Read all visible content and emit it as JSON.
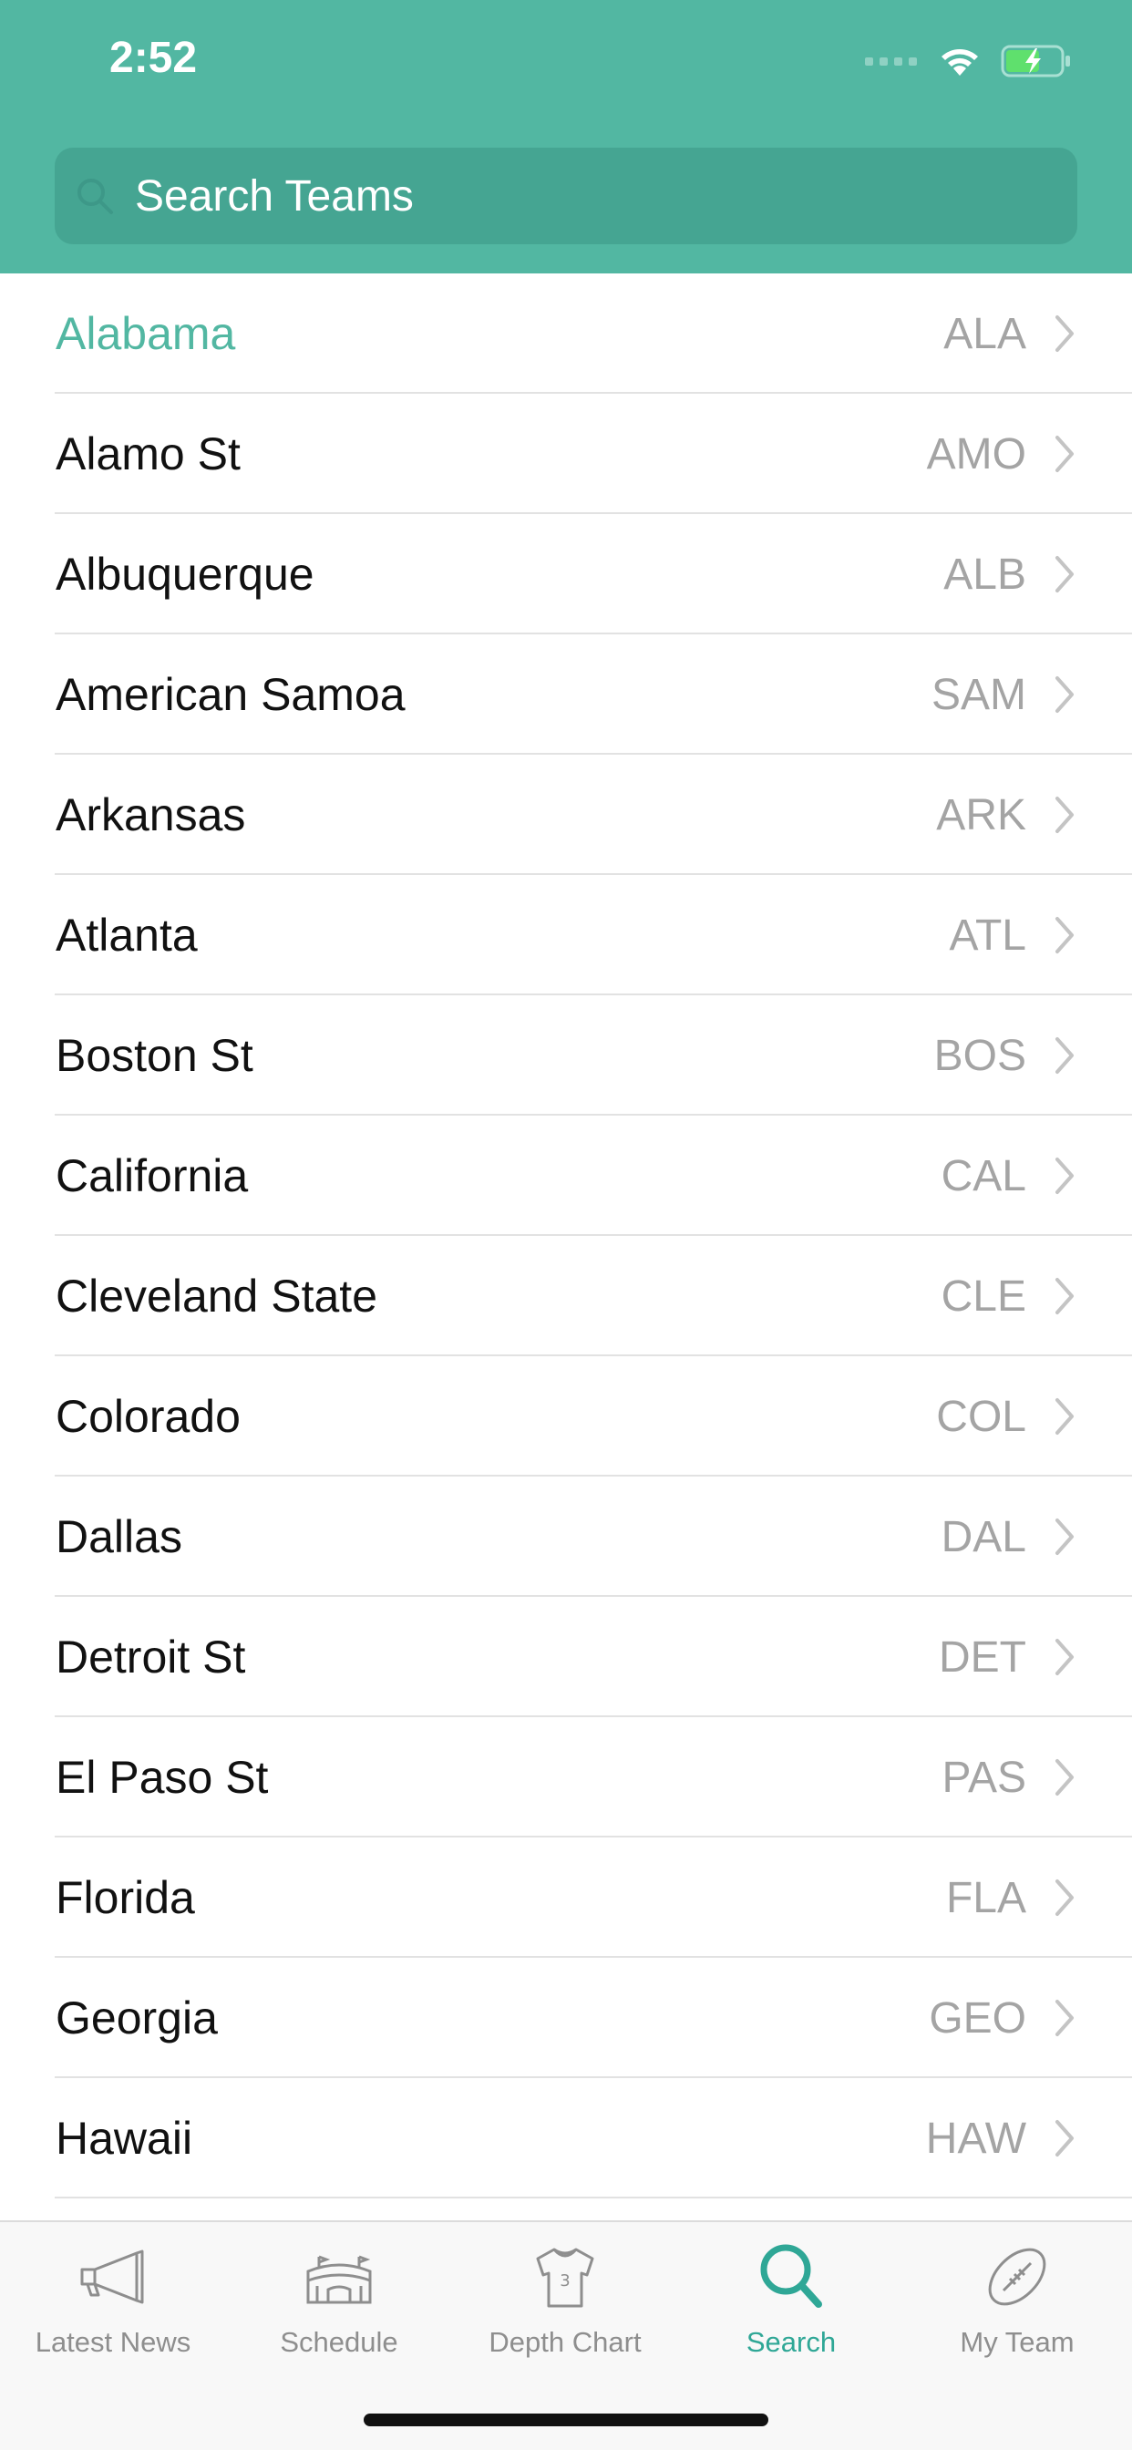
{
  "status_bar": {
    "time": "2:52"
  },
  "search": {
    "placeholder": "Search Teams"
  },
  "teams": [
    {
      "name": "Alabama",
      "abbr": "ALA"
    },
    {
      "name": "Alamo St",
      "abbr": "AMO"
    },
    {
      "name": "Albuquerque",
      "abbr": "ALB"
    },
    {
      "name": "American Samoa",
      "abbr": "SAM"
    },
    {
      "name": "Arkansas",
      "abbr": "ARK"
    },
    {
      "name": "Atlanta",
      "abbr": "ATL"
    },
    {
      "name": "Boston St",
      "abbr": "BOS"
    },
    {
      "name": "California",
      "abbr": "CAL"
    },
    {
      "name": "Cleveland State",
      "abbr": "CLE"
    },
    {
      "name": "Colorado",
      "abbr": "COL"
    },
    {
      "name": "Dallas",
      "abbr": "DAL"
    },
    {
      "name": "Detroit St",
      "abbr": "DET"
    },
    {
      "name": "El Paso St",
      "abbr": "PAS"
    },
    {
      "name": "Florida",
      "abbr": "FLA"
    },
    {
      "name": "Georgia",
      "abbr": "GEO"
    },
    {
      "name": "Hawaii",
      "abbr": "HAW"
    }
  ],
  "tab_bar": {
    "tabs": [
      {
        "label": "Latest News",
        "icon": "megaphone-icon"
      },
      {
        "label": "Schedule",
        "icon": "stadium-icon"
      },
      {
        "label": "Depth Chart",
        "icon": "jersey-icon"
      },
      {
        "label": "Search",
        "icon": "search-icon"
      },
      {
        "label": "My Team",
        "icon": "football-icon"
      }
    ],
    "active": "Search"
  },
  "colors": {
    "accent": "#52b7a2",
    "header": "#52b7a2",
    "search_field": "#45a592"
  }
}
